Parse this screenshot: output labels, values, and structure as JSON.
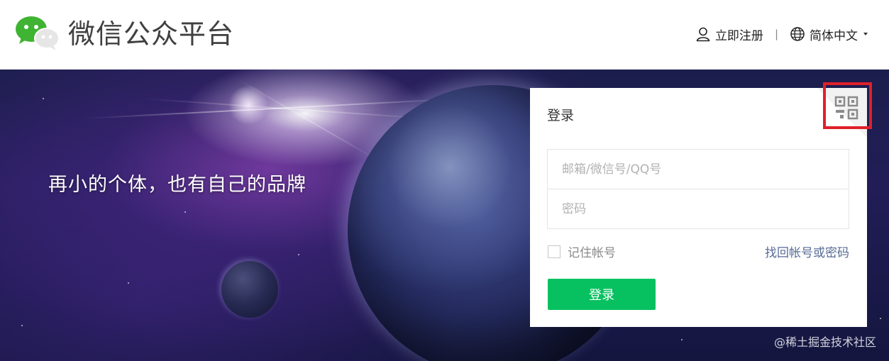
{
  "header": {
    "brand_title": "微信公众平台",
    "register_label": "立即注册",
    "separator": "|",
    "language_label": "简体中文",
    "icons": [
      "wechat-logo",
      "user-icon",
      "globe-icon",
      "caret-down-icon"
    ]
  },
  "banner": {
    "slogan": "再小的个体，也有自己的品牌"
  },
  "login": {
    "title": "登录",
    "account_placeholder": "邮箱/微信号/QQ号",
    "account_value": "",
    "password_placeholder": "密码",
    "password_value": "",
    "remember_label": "记住帐号",
    "remember_checked": false,
    "forgot_label": "找回帐号或密码",
    "submit_label": "登录",
    "qr_icon": "qr-code-icon"
  },
  "watermark": "@稀土掘金技术社区",
  "colors": {
    "accent_green": "#07c160",
    "link_blue": "#576b95",
    "highlight_red": "#e0202a",
    "wechat_green": "#3fb332"
  }
}
